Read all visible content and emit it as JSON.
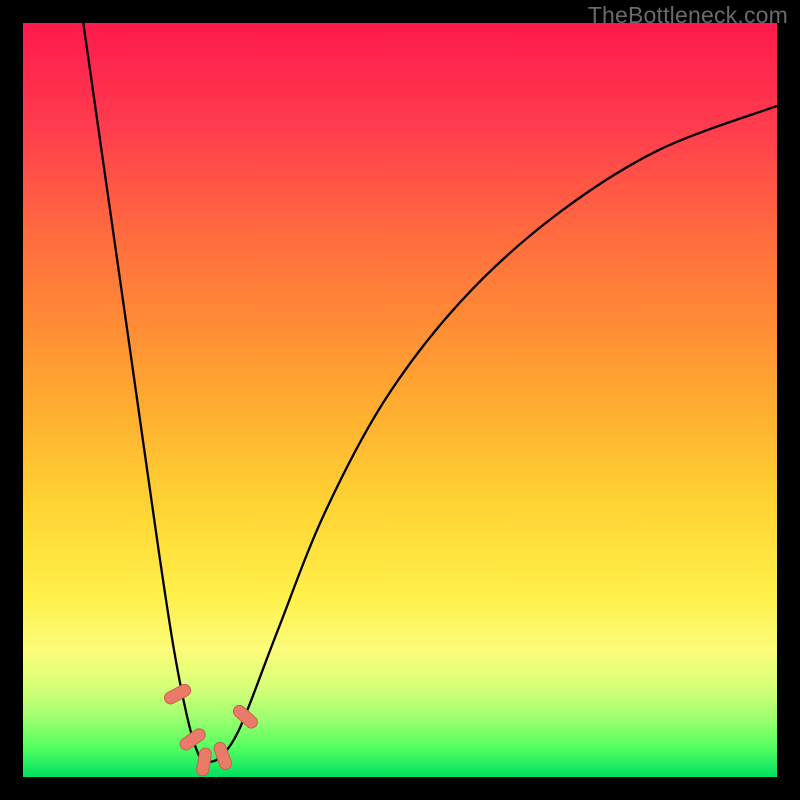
{
  "watermark": "TheBottleneck.com",
  "colors": {
    "background": "#000000",
    "curve_stroke": "#000000",
    "marker_fill": "#e97b68",
    "marker_stroke": "#c9604f"
  },
  "chart_data": {
    "type": "line",
    "title": "",
    "xlabel": "",
    "ylabel": "",
    "xlim": [
      0,
      100
    ],
    "ylim": [
      0,
      100
    ],
    "grid": false,
    "legend": false,
    "series": [
      {
        "name": "curve",
        "x": [
          8,
          10,
          12,
          14,
          16,
          18,
          20,
          22,
          23.5,
          24.5,
          26,
          28,
          30,
          34,
          40,
          48,
          58,
          70,
          84,
          100
        ],
        "y": [
          100,
          86,
          72,
          58,
          44,
          30,
          17,
          7,
          2.5,
          2,
          2.5,
          5,
          9.5,
          20,
          35,
          50,
          63,
          74,
          83,
          89
        ]
      }
    ],
    "markers": [
      {
        "x": 20.5,
        "y": 11,
        "angle": 62
      },
      {
        "x": 22.5,
        "y": 5,
        "angle": 55
      },
      {
        "x": 24.0,
        "y": 2,
        "angle": 10
      },
      {
        "x": 26.5,
        "y": 2.8,
        "angle": -20
      },
      {
        "x": 29.5,
        "y": 8,
        "angle": -48
      }
    ],
    "note": "Values are read off the figure in percent of plot width/height. Curve is approximated from visual positions of the black stroke; markers are the pink rounded dashes near the bottom of the V."
  }
}
